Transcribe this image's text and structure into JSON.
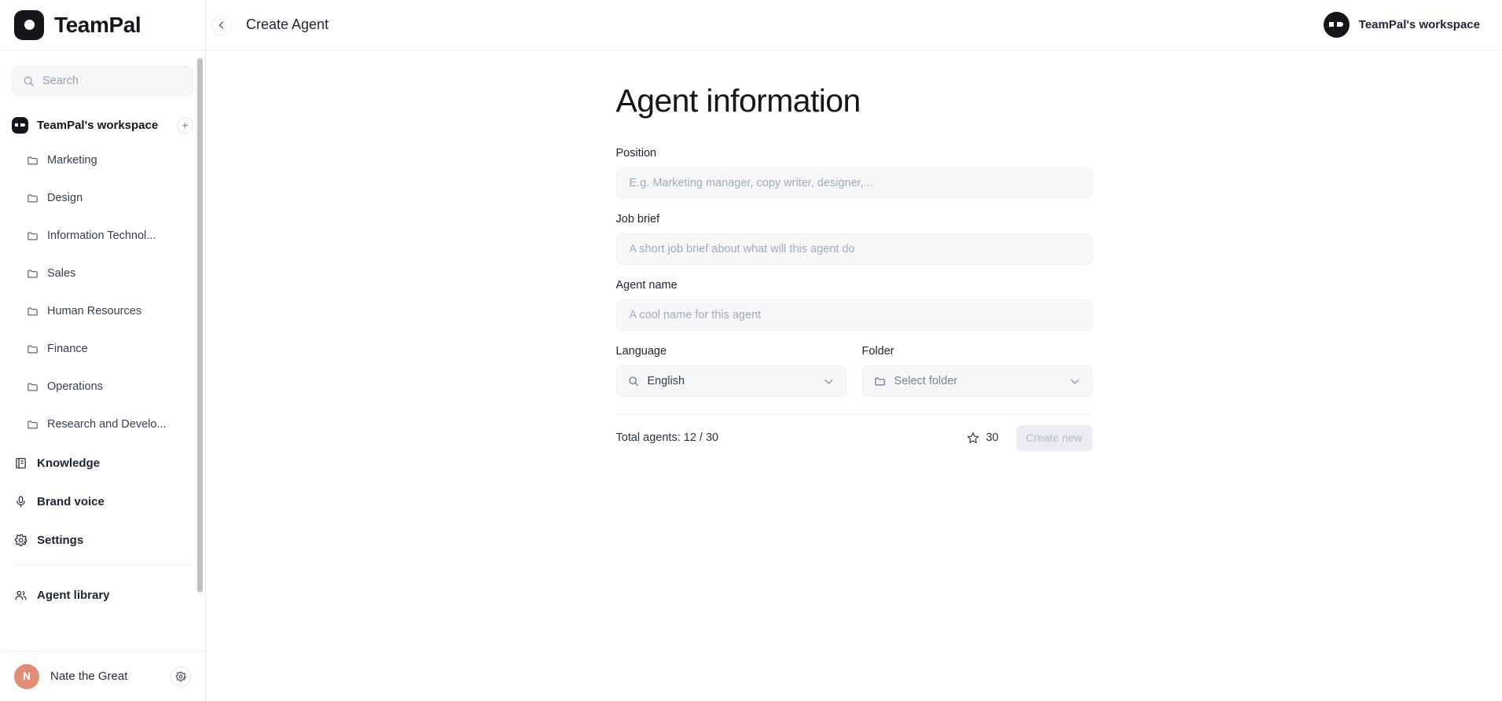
{
  "brand": {
    "name": "TeamPal",
    "logo_icon": "teampal-dot-logo"
  },
  "sidebar": {
    "search": {
      "placeholder": "Search",
      "value": "",
      "icon": "search-icon"
    },
    "workspace": {
      "name": "TeamPal's workspace",
      "add_label": "+",
      "avatar_icon": "workspace-avatar-icon"
    },
    "folders": [
      {
        "label": "Marketing",
        "icon": "folder-icon"
      },
      {
        "label": "Design",
        "icon": "folder-icon"
      },
      {
        "label": "Information Technol...",
        "icon": "folder-icon"
      },
      {
        "label": "Sales",
        "icon": "folder-icon"
      },
      {
        "label": "Human Resources",
        "icon": "folder-icon"
      },
      {
        "label": "Finance",
        "icon": "folder-icon"
      },
      {
        "label": "Operations",
        "icon": "folder-icon"
      },
      {
        "label": "Research and Develo...",
        "icon": "folder-icon"
      }
    ],
    "nav": [
      {
        "label": "Knowledge",
        "icon": "book-icon"
      },
      {
        "label": "Brand voice",
        "icon": "microphone-icon"
      },
      {
        "label": "Settings",
        "icon": "gear-icon"
      }
    ],
    "footer_nav": [
      {
        "label": "Agent library",
        "icon": "users-icon"
      }
    ],
    "user": {
      "name": "Nate the Great",
      "initial": "N",
      "settings_icon": "gear-icon",
      "avatar_color": "#df8d74"
    }
  },
  "topbar": {
    "back_icon": "chevron-left-icon",
    "title": "Create Agent",
    "workspace_label": "TeamPal's workspace",
    "workspace_avatar_icon": "workspace-avatar-icon"
  },
  "form": {
    "heading": "Agent information",
    "position": {
      "label": "Position",
      "placeholder": "E.g. Marketing manager, copy writer, designer,...",
      "value": ""
    },
    "job_brief": {
      "label": "Job brief",
      "placeholder": "A short job brief about what will this agent do",
      "value": ""
    },
    "agent_name": {
      "label": "Agent name",
      "placeholder": "A cool name for this agent",
      "value": ""
    },
    "language": {
      "label": "Language",
      "value": "English",
      "icon": "search-icon",
      "chevron_icon": "chevron-down-icon"
    },
    "folder": {
      "label": "Folder",
      "value": "Select folder",
      "icon": "folder-icon",
      "chevron_icon": "chevron-down-icon"
    },
    "footer": {
      "total_agents": "Total agents: 12 / 30",
      "credits": "30",
      "credits_icon": "star-icon",
      "create_label": "Create new",
      "create_disabled": true
    }
  },
  "colors": {
    "accent_dark": "#15161a",
    "avatar_orange": "#df8d74",
    "input_bg": "#f6f7f9",
    "muted_text": "#a6aab1",
    "disabled_btn_bg": "#eaecef"
  }
}
